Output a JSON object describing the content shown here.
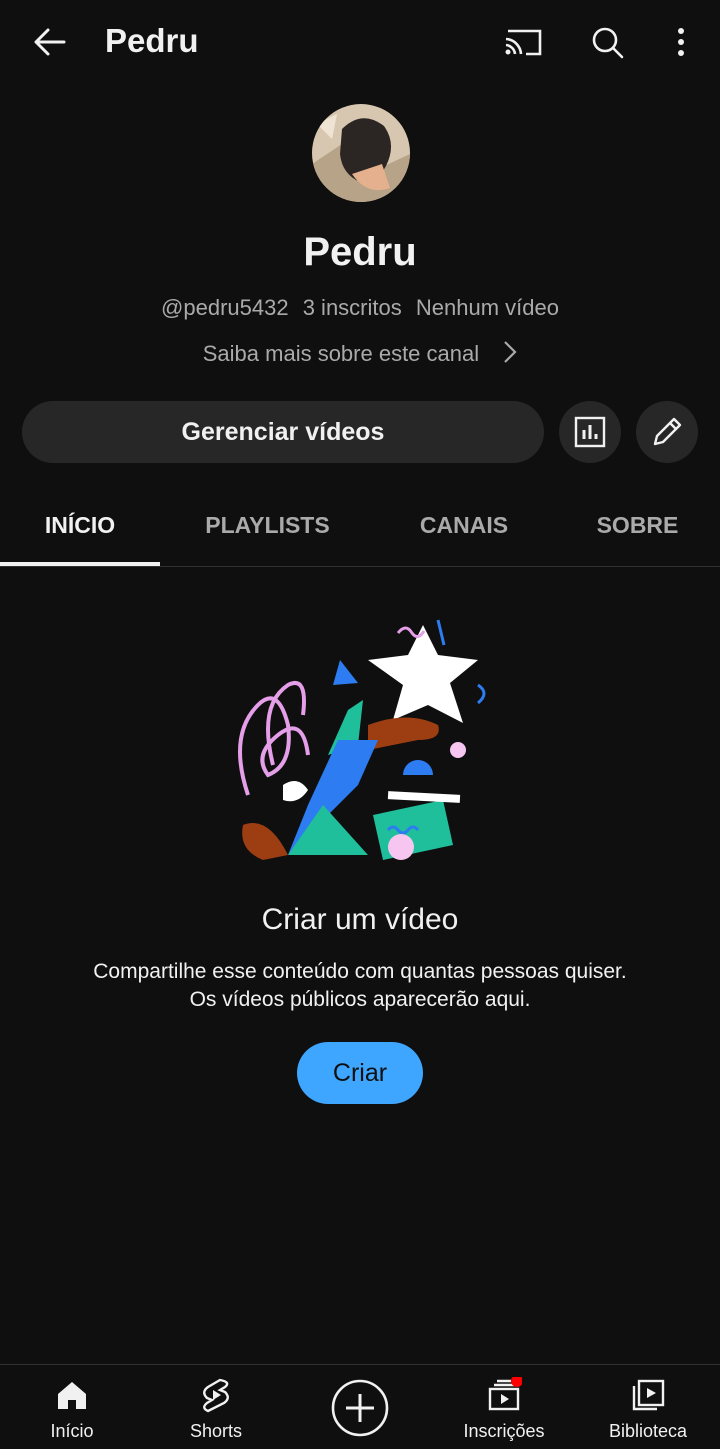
{
  "header": {
    "title": "Pedru",
    "back_icon": "arrow-left-icon",
    "cast_icon": "cast-icon",
    "search_icon": "search-icon",
    "more_icon": "more-vert-icon"
  },
  "channel": {
    "name": "Pedru",
    "handle": "@pedru5432",
    "subscribers": "3 inscritos",
    "videos": "Nenhum vídeo",
    "about_link": "Saiba mais sobre este canal"
  },
  "actions": {
    "manage_label": "Gerenciar vídeos",
    "analytics_icon": "analytics-icon",
    "edit_icon": "pencil-icon"
  },
  "tabs": [
    {
      "label": "INÍCIO",
      "active": true
    },
    {
      "label": "PLAYLISTS",
      "active": false
    },
    {
      "label": "CANAIS",
      "active": false
    },
    {
      "label": "SOBRE",
      "active": false
    }
  ],
  "empty_state": {
    "title": "Criar um vídeo",
    "description_line1": "Compartilhe esse conteúdo com quantas pessoas quiser.",
    "description_line2": "Os vídeos públicos aparecerão aqui.",
    "button_label": "Criar"
  },
  "bottom_nav": [
    {
      "label": "Início",
      "icon": "home-icon"
    },
    {
      "label": "Shorts",
      "icon": "shorts-icon"
    },
    {
      "label": "",
      "icon": "create-plus-icon"
    },
    {
      "label": "Inscrições",
      "icon": "subscriptions-icon",
      "badge": true
    },
    {
      "label": "Biblioteca",
      "icon": "library-icon"
    }
  ],
  "colors": {
    "background": "#0f0f0f",
    "button_bg": "#272727",
    "accent_blue": "#3ea6ff",
    "badge_red": "#ff0000",
    "muted_text": "#aaaaaa"
  }
}
